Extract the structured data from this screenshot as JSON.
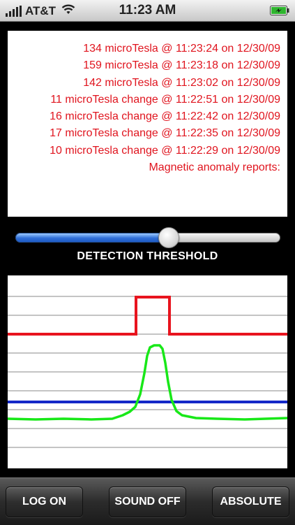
{
  "status_bar": {
    "carrier": "AT&T",
    "time": "11:23 AM",
    "icons": [
      "signal-icon",
      "wifi-icon",
      "battery-charging-icon"
    ]
  },
  "reports": {
    "lines": [
      "134 microTesla @ 11:23:24 on 12/30/09",
      "159 microTesla @ 11:23:18 on 12/30/09",
      "142 microTesla @ 11:23:02 on 12/30/09",
      "11 microTesla change @ 11:22:51 on 12/30/09",
      "16 microTesla change @ 11:22:42 on 12/30/09",
      "17 microTesla change @ 11:22:35 on 12/30/09",
      "10 microTesla change @ 11:22:29 on 12/30/09"
    ],
    "header": "Magnetic anomaly reports:",
    "color": "#e0141e"
  },
  "threshold": {
    "label": "DETECTION THRESHOLD",
    "value_fraction": 0.58
  },
  "graph": {
    "colors": {
      "alarm": "#e8141e",
      "signal": "#18e818",
      "threshold": "#1428c8",
      "grid": "#888888"
    }
  },
  "toolbar": {
    "log_label": "LOG ON",
    "sound_label": "SOUND OFF",
    "mode_label": "ABSOLUTE"
  }
}
